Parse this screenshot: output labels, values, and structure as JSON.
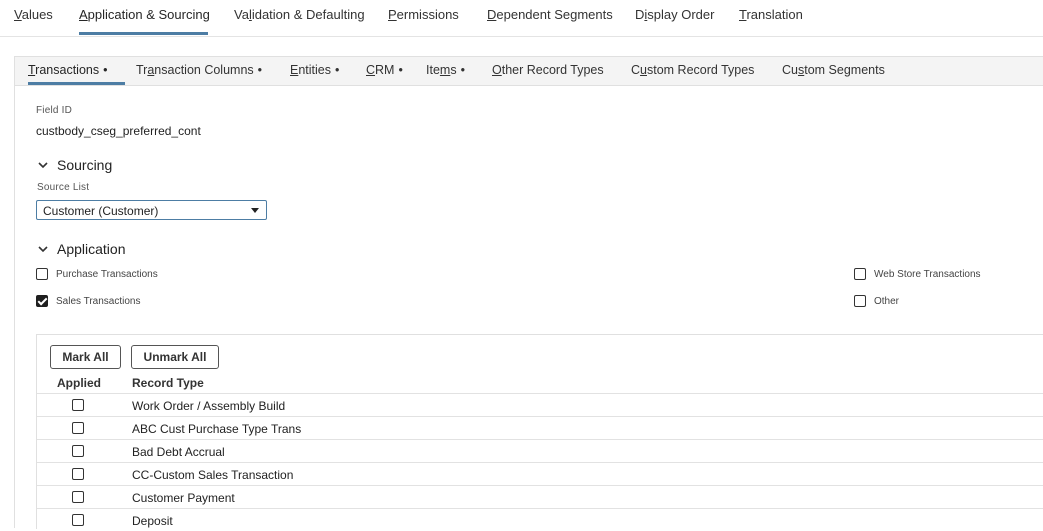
{
  "top_tabs": [
    {
      "label": "Values",
      "active": false
    },
    {
      "label": "Application & Sourcing",
      "active": true
    },
    {
      "label": "Validation & Defaulting",
      "active": false
    },
    {
      "label": "Permissions",
      "active": false
    },
    {
      "label": "Dependent Segments",
      "active": false
    },
    {
      "label": "Display Order",
      "active": false
    },
    {
      "label": "Translation",
      "active": false
    }
  ],
  "sub_tabs": [
    {
      "label": "Transactions",
      "dot": "•",
      "active": true
    },
    {
      "label": "Transaction Columns",
      "dot": "•",
      "active": false
    },
    {
      "label": "Entities",
      "dot": "•",
      "active": false
    },
    {
      "label": "CRM",
      "dot": "•",
      "active": false
    },
    {
      "label": "Items",
      "dot": "•",
      "active": false
    },
    {
      "label": "Other Record Types",
      "dot": "",
      "active": false
    },
    {
      "label": "Custom Record Types",
      "dot": "",
      "active": false
    },
    {
      "label": "Custom Segments",
      "dot": "",
      "active": false
    }
  ],
  "field_id": {
    "label": "Field ID",
    "value": "custbody_cseg_preferred_cont"
  },
  "sourcing": {
    "title": "Sourcing",
    "source_list_label": "Source List",
    "source_list_value": "Customer (Customer)"
  },
  "application": {
    "title": "Application",
    "checks": [
      {
        "label": "Purchase Transactions",
        "checked": false
      },
      {
        "label": "Sales Transactions",
        "checked": true
      },
      {
        "label": "Web Store Transactions",
        "checked": false
      },
      {
        "label": "Other",
        "checked": false
      }
    ]
  },
  "record_table": {
    "mark_all": "Mark All",
    "unmark_all": "Unmark All",
    "headers": {
      "applied": "Applied",
      "record_type": "Record Type"
    },
    "rows": [
      {
        "label": "Work Order / Assembly Build",
        "applied": false
      },
      {
        "label": "ABC Cust Purchase Type Trans",
        "applied": false
      },
      {
        "label": "Bad Debt Accrual",
        "applied": false
      },
      {
        "label": "CC-Custom Sales Transaction",
        "applied": false
      },
      {
        "label": "Customer Payment",
        "applied": false
      },
      {
        "label": "Deposit",
        "applied": false
      }
    ]
  },
  "colors": {
    "accent": "#4d7da4",
    "checked": "#1f1f1f"
  },
  "icons": {
    "section_toggle": "chevron-down-icon",
    "select_caret": "caret-down-icon"
  }
}
